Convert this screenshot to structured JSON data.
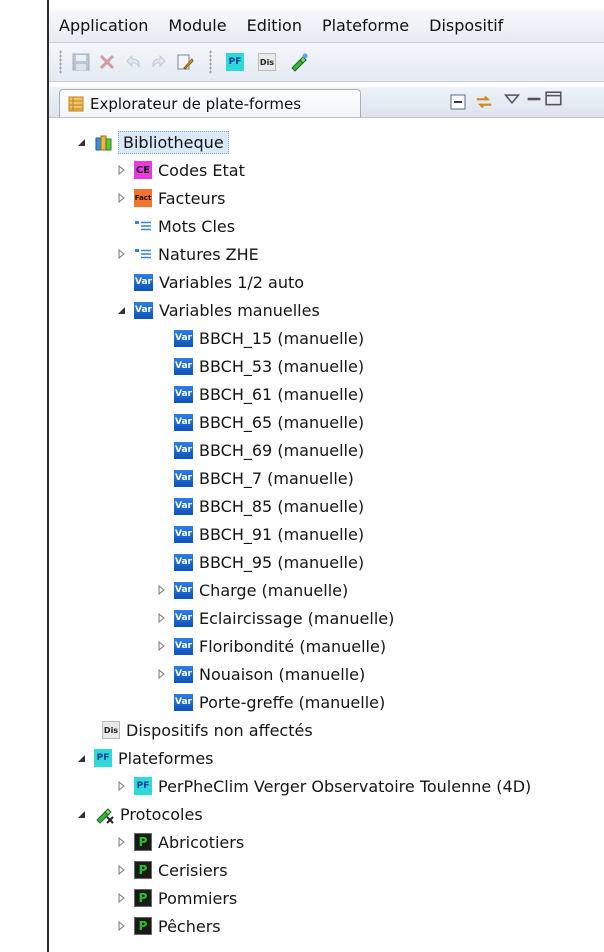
{
  "menubar": {
    "items": [
      "Application",
      "Module",
      "Edition",
      "Plateforme",
      "Dispositif"
    ]
  },
  "toolbar": {
    "buttons": [
      "save-icon",
      "delete-icon",
      "undo-icon",
      "redo-icon",
      "edit-icon",
      "new-plateforme-icon",
      "new-dispositif-icon",
      "protocol-icon"
    ],
    "pf_label": "PF",
    "dis_label": "Dis"
  },
  "panel": {
    "title": "Explorateur de plate-formes"
  },
  "tree": {
    "root": "Bibliotheque",
    "codes_etat": "Codes Etat",
    "facteurs": "Facteurs",
    "mots_cles": "Mots Cles",
    "natures_zhe": "Natures ZHE",
    "variables_auto": "Variables 1/2 auto",
    "variables_manuelles": "Variables manuelles",
    "manual_vars": [
      "BBCH_15 (manuelle)",
      "BBCH_53 (manuelle)",
      "BBCH_61 (manuelle)",
      "BBCH_65 (manuelle)",
      "BBCH_69 (manuelle)",
      "BBCH_7 (manuelle)",
      "BBCH_85 (manuelle)",
      "BBCH_91 (manuelle)",
      "BBCH_95 (manuelle)",
      "Charge (manuelle)",
      "Eclaircissage (manuelle)",
      "Floribondité (manuelle)",
      "Nouaison (manuelle)",
      "Porte-greffe (manuelle)"
    ],
    "dispositifs": "Dispositifs non affectés",
    "plateformes": "Plateformes",
    "plateforme_child": "PerPheClim Verger Observatoire Toulenne (4D)",
    "protocoles": "Protocoles",
    "protocol_children": [
      "Abricotiers",
      "Cerisiers",
      "Pommiers",
      "Pêchers"
    ],
    "icon_labels": {
      "var": "Var",
      "ce": "CE",
      "fact": "Fact",
      "pf": "PF",
      "dis": "Dis",
      "p": "P"
    }
  }
}
